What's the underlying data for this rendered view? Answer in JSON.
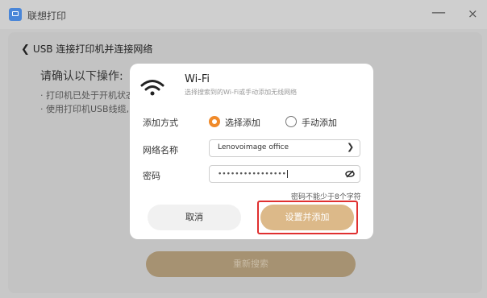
{
  "app": {
    "title": "联想打印"
  },
  "window": {
    "minimize": "—",
    "close": "×"
  },
  "page": {
    "back_label": "USB 连接打印机并连接网络",
    "instructions_title": "请确认以下操作:",
    "instructions": [
      "· 打印机已处于开机状态",
      "· 使用打印机USB线缆,"
    ],
    "rescan_label": "重新搜索"
  },
  "dialog": {
    "wifi_title": "Wi-Fi",
    "wifi_subtitle": "选择搜索到的Wi-Fi或手动添加无线网络",
    "method_label": "添加方式",
    "option_select": "选择添加",
    "option_manual": "手动添加",
    "selected_method": "选择添加",
    "network_label": "网络名称",
    "network_value": "Lenovoimage office",
    "password_label": "密码",
    "password_value": "••••••••••••••••",
    "password_hint": "密码不能少于8个字符",
    "cancel_label": "取消",
    "confirm_label": "设置并添加"
  },
  "colors": {
    "accent": "#f08a2a",
    "confirm_button": "#dcb989",
    "highlight": "#e03030"
  }
}
